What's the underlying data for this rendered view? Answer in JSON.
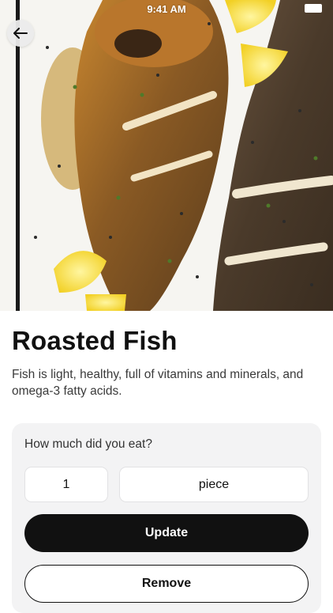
{
  "status_bar": {
    "time": "9:41 AM"
  },
  "hero": {
    "image": "roasted-fish-photo"
  },
  "food": {
    "name": "Roasted Fish",
    "description": "Fish is light, healthy, full of vitamins and minerals, and omega-3 fatty acids."
  },
  "portion": {
    "question": "How much did you eat?",
    "quantity": "1",
    "unit": "piece"
  },
  "actions": {
    "update_label": "Update",
    "remove_label": "Remove"
  },
  "colors": {
    "primary_button": "#111111",
    "card_background": "#f3f3f4"
  }
}
